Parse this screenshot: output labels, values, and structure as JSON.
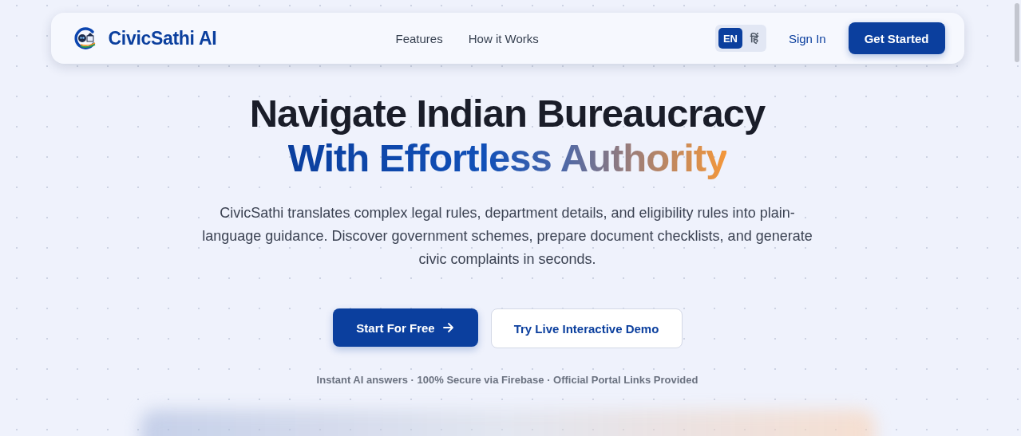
{
  "nav": {
    "brand": "CivicSathi AI",
    "links": [
      "Features",
      "How it Works"
    ],
    "languages": [
      {
        "label": "EN",
        "selected": true
      },
      {
        "label": "हिं",
        "selected": false
      }
    ],
    "sign_in": "Sign In",
    "cta": "Get Started"
  },
  "hero": {
    "title_line_1": "Navigate Indian Bureaucracy",
    "title_line_2": "With Effortless Authority",
    "description": "CivicSathi translates complex legal rules, department details, and eligibility rules into plain-language guidance. Discover government schemes, prepare document checklists, and generate civic complaints in seconds.",
    "primary_button": "Start For Free",
    "secondary_button": "Try Live Interactive Demo",
    "note": "Instant AI answers · 100% Secure via Firebase · Official Portal Links Provided"
  }
}
